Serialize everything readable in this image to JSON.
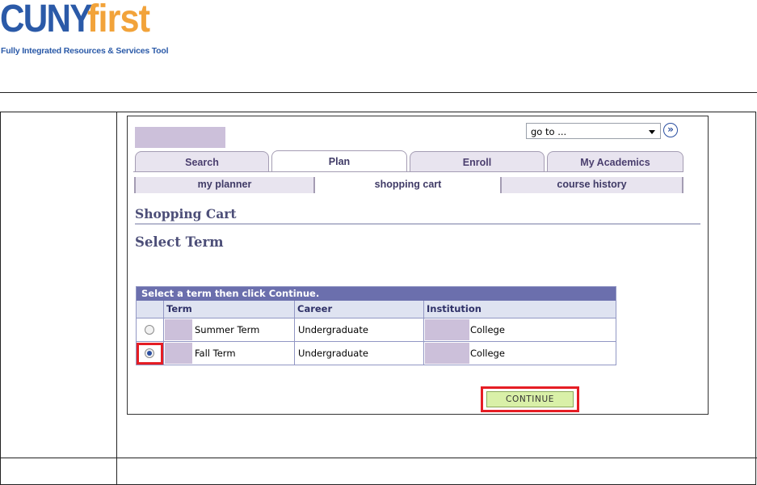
{
  "header": {
    "logo_cuny": "CUNY",
    "logo_first": "first",
    "logo_tagline": "Fully Integrated Resources & Services Tool"
  },
  "nav": {
    "goto_value": "go to ...",
    "tabs": [
      {
        "label": "Search",
        "active": false
      },
      {
        "label": "Plan",
        "active": true
      },
      {
        "label": "Enroll",
        "active": false
      },
      {
        "label": "My Academics",
        "active": false
      }
    ],
    "subtabs": [
      {
        "label": "my planner",
        "active": false
      },
      {
        "label": "shopping cart",
        "active": true
      },
      {
        "label": "course history",
        "active": false
      }
    ]
  },
  "page": {
    "section_title": "Shopping Cart",
    "subtitle": "Select Term"
  },
  "term_grid": {
    "title": "Select a term then click Continue.",
    "columns": [
      "Term",
      "Career",
      "Institution"
    ],
    "rows": [
      {
        "term": "Summer Term",
        "career": "Undergraduate",
        "institution": "College",
        "selected": false
      },
      {
        "term": "Fall Term",
        "career": "Undergraduate",
        "institution": "College",
        "selected": true
      }
    ]
  },
  "actions": {
    "continue_label": "CONTINUE"
  },
  "colors": {
    "highlight_red": "#e51d24",
    "redaction": "#ccc0da",
    "grid_header": "#6b6fad",
    "continue_button": "#d9f0a8"
  }
}
